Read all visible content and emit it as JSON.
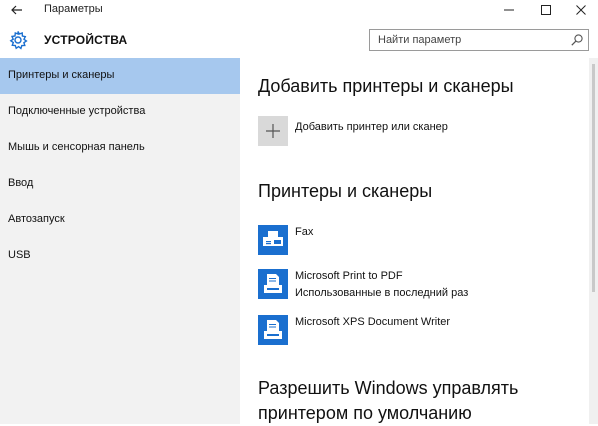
{
  "window": {
    "title": "Параметры",
    "back_icon": "back-arrow-icon",
    "minimize_icon": "minimize-icon",
    "maximize_icon": "maximize-icon",
    "close_icon": "close-icon"
  },
  "header": {
    "icon": "gear-icon",
    "title": "УСТРОЙСТВА",
    "search": {
      "placeholder": "Найти параметр",
      "icon": "search-icon"
    }
  },
  "sidebar": {
    "items": [
      {
        "label": "Принтеры и сканеры",
        "active": true
      },
      {
        "label": "Подключенные устройства",
        "active": false
      },
      {
        "label": "Мышь и сенсорная панель",
        "active": false
      },
      {
        "label": "Ввод",
        "active": false
      },
      {
        "label": "Автозапуск",
        "active": false
      },
      {
        "label": "USB",
        "active": false
      }
    ]
  },
  "main": {
    "add_section": {
      "heading": "Добавить принтеры и сканеры",
      "add_button_label": "Добавить принтер или сканер",
      "add_icon": "plus-icon"
    },
    "printers_section": {
      "heading": "Принтеры и сканеры",
      "printers": [
        {
          "name": "Fax",
          "status": "",
          "icon": "fax-printer-icon"
        },
        {
          "name": "Microsoft Print to PDF",
          "status": "Использованные в последний раз",
          "icon": "printer-icon"
        },
        {
          "name": "Microsoft XPS Document Writer",
          "status": "",
          "icon": "printer-icon"
        }
      ]
    },
    "default_section": {
      "heading_line1": "Разрешить Windows управлять",
      "heading_line2": "принтером по умолчанию"
    }
  },
  "colors": {
    "accent": "#1a6fcf",
    "sidebar_bg": "#f2f2f2",
    "sidebar_active": "#a6c8ee",
    "add_tile_bg": "#d9d9d9"
  }
}
